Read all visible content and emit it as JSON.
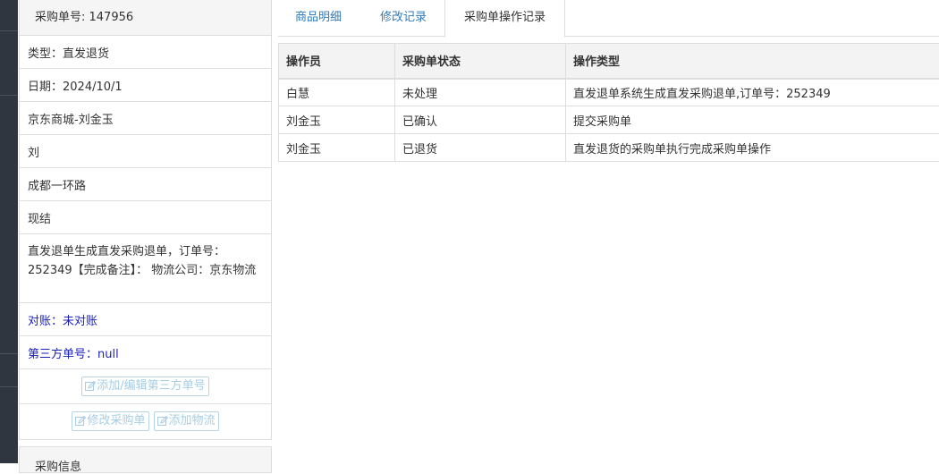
{
  "left_panel": {
    "order_no_label": "采购单号: 147956",
    "fields": {
      "type": "类型：直发退货",
      "date": "日期：2024/10/1",
      "store": "京东商城-刘金玉",
      "contact": "刘",
      "address": "成都一环路",
      "settlement": "现结",
      "remark": "直发退单生成直发采购退单，订单号：252349【完成备注】： 物流公司：京东物流",
      "reconcile": "对账：未对账",
      "third_party": "第三方单号：null"
    },
    "buttons": {
      "add_edit_third_party": "添加/编辑第三方单号",
      "modify_order": "修改采购单",
      "add_logistics": "添加物流"
    },
    "next_panel_title": "采购信息"
  },
  "tabs": [
    "商品明细",
    "修改记录",
    "采购单操作记录"
  ],
  "table": {
    "headers": [
      "操作员",
      "采购单状态",
      "操作类型"
    ],
    "rows": [
      [
        "白慧",
        "未处理",
        "直发退单系统生成直发采购退单,订单号：252349"
      ],
      [
        "刘金玉",
        "已确认",
        "提交采购单"
      ],
      [
        "刘金玉",
        "已退货",
        "直发退货的采购单执行完成采购单操作"
      ]
    ]
  },
  "colors": {
    "link": "#337ab7",
    "blue_text": "#1a21b8",
    "button_text": "#a6cde3",
    "sidebar": "#2f3640"
  },
  "icons": {
    "button_icon": "edit-icon"
  }
}
